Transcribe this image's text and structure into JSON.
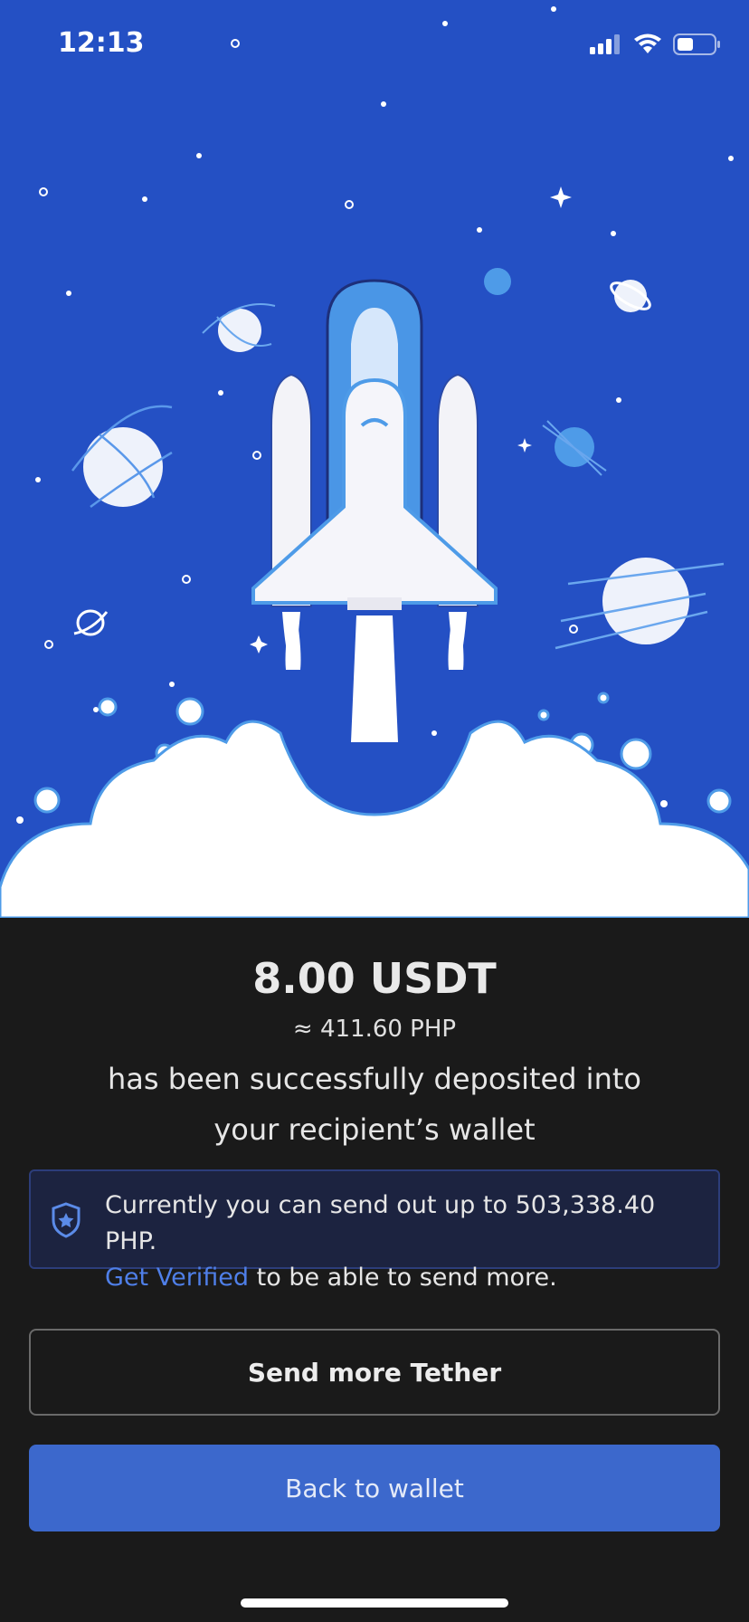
{
  "status_bar": {
    "time": "12:13",
    "icons": [
      "cellular-signal-icon",
      "wifi-icon",
      "battery-icon"
    ]
  },
  "hero": {
    "illustration": "rocket-launch-illustration",
    "background_color": "#2450c4"
  },
  "result": {
    "amount": "8.00 USDT",
    "approx": "≈ 411.60 PHP",
    "message": "has been successfully deposited into your recipient’s wallet"
  },
  "notice": {
    "icon": "shield-star-icon",
    "text_prefix": "Currently you can send out up to 503,338.40 PHP.",
    "link_label": "Get Verified",
    "text_suffix": " to be able to send more."
  },
  "actions": {
    "send_more_label": "Send more Tether",
    "back_label": "Back to wallet"
  },
  "colors": {
    "accent": "#3c68cc",
    "link": "#4f7fe8",
    "page_bg": "#1a1a1a"
  }
}
